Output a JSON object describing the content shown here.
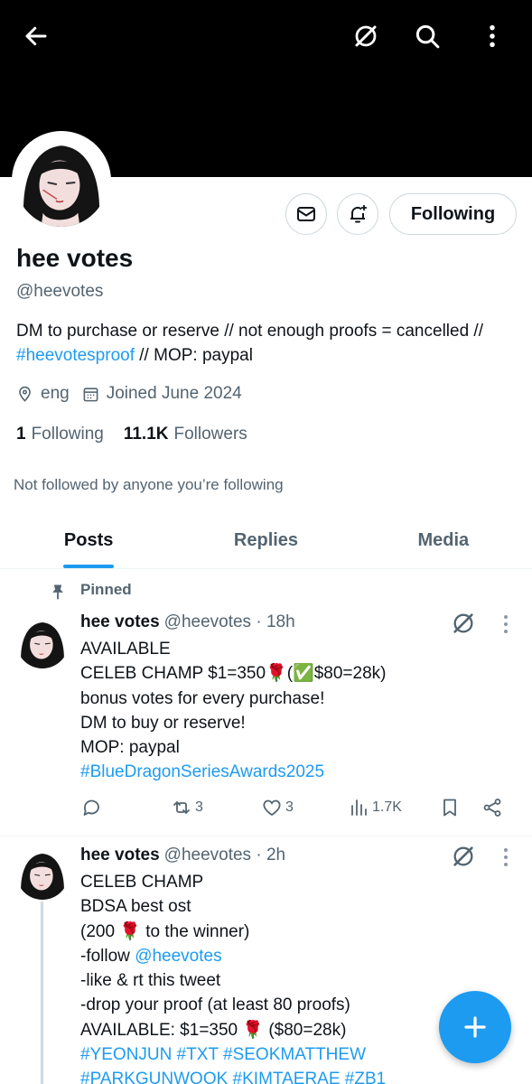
{
  "topbar": {
    "back_icon": "arrow-left-icon",
    "grok_icon": "grok-icon",
    "search_icon": "search-icon",
    "more_icon": "more-vertical-icon"
  },
  "profile": {
    "name": "hee votes",
    "handle": "@heevotes",
    "bio_text_1": "DM to purchase or reserve // not enough proofs = cancelled // ",
    "bio_link": "#heevotesproof",
    "bio_text_2": " // MOP: paypal",
    "location": "eng",
    "joined": "Joined June 2024",
    "following_count": "1",
    "following_label": "Following",
    "followers_count": "11.1K",
    "followers_label": "Followers",
    "not_followed": "Not followed by anyone you’re following",
    "following_button": "Following"
  },
  "tabs": [
    {
      "label": "Posts",
      "active": true
    },
    {
      "label": "Replies",
      "active": false
    },
    {
      "label": "Media",
      "active": false
    }
  ],
  "posts": [
    {
      "pinned_label": "Pinned",
      "name": "hee votes",
      "handle_time": "@heevotes · 18h",
      "line1": "AVAILABLE",
      "line2": "CELEB CHAMP $1=350🌹(✅$80=28k)",
      "line3": "bonus votes for every purchase!",
      "line4": "DM to buy or reserve!",
      "line5": "MOP: paypal",
      "line6": "#BlueDragonSeriesAwards2025",
      "replies": "",
      "reposts": "3",
      "likes": "3",
      "views": "1.7K"
    },
    {
      "name": "hee votes",
      "handle_time": "@heevotes · 2h",
      "line1": "CELEB CHAMP",
      "line2": "BDSA best ost",
      "line3": "(200 🌹 to the winner)",
      "line4_prefix": "-follow ",
      "line4_link": "@heevotes",
      "line5": "-like & rt this tweet",
      "line6": "-drop your proof (at least 80 proofs)",
      "line7": "AVAILABLE: $1=350 🌹 ($80=28k)",
      "line8": "#YEONJUN #TXT #SEOKMATTHEW",
      "line9": "#PARKGUNWOOK #KIMTAERAE #ZB1"
    }
  ],
  "colors": {
    "accent": "#1d9bf0",
    "text": "#0f1419",
    "secondary": "#536471",
    "banner": "#000000"
  }
}
